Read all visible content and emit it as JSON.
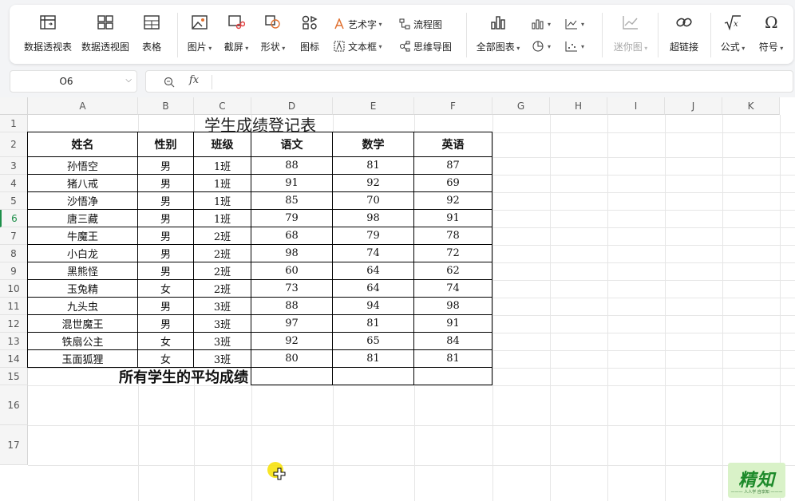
{
  "ribbon": {
    "pivot_table": "数据透视表",
    "pivot_chart": "数据透视图",
    "table": "表格",
    "picture": "图片",
    "screenshot": "截屏",
    "shapes": "形状",
    "icons": "图标",
    "wordart": "艺术字",
    "textbox": "文本框",
    "flowchart": "流程图",
    "mindmap": "思维导图",
    "all_charts": "全部图表",
    "sparkline": "迷你图",
    "hyperlink": "超链接",
    "formula": "公式",
    "symbol": "符号"
  },
  "formula_bar": {
    "name_box": "O6",
    "fx": "fx",
    "value": ""
  },
  "columns": [
    "A",
    "B",
    "C",
    "D",
    "E",
    "F",
    "G",
    "H",
    "I",
    "J",
    "K"
  ],
  "rows": [
    "1",
    "2",
    "3",
    "4",
    "5",
    "6",
    "7",
    "8",
    "9",
    "10",
    "11",
    "12",
    "13",
    "14",
    "15",
    "16",
    "17"
  ],
  "sheet": {
    "title": "学生成绩登记表",
    "headers": [
      "姓名",
      "性别",
      "班级",
      "语文",
      "数学",
      "英语"
    ],
    "data": [
      [
        "孙悟空",
        "男",
        "1班",
        "88",
        "81",
        "87"
      ],
      [
        "猪八戒",
        "男",
        "1班",
        "91",
        "92",
        "69"
      ],
      [
        "沙悟净",
        "男",
        "1班",
        "85",
        "70",
        "92"
      ],
      [
        "唐三藏",
        "男",
        "1班",
        "79",
        "98",
        "91"
      ],
      [
        "牛魔王",
        "男",
        "2班",
        "68",
        "79",
        "78"
      ],
      [
        "小白龙",
        "男",
        "2班",
        "98",
        "74",
        "72"
      ],
      [
        "黑熊怪",
        "男",
        "2班",
        "60",
        "64",
        "62"
      ],
      [
        "玉兔精",
        "女",
        "2班",
        "73",
        "64",
        "74"
      ],
      [
        "九头虫",
        "男",
        "3班",
        "88",
        "94",
        "98"
      ],
      [
        "混世魔王",
        "男",
        "3班",
        "97",
        "81",
        "91"
      ],
      [
        "铁扇公主",
        "女",
        "3班",
        "92",
        "65",
        "84"
      ],
      [
        "玉面狐狸",
        "女",
        "3班",
        "80",
        "81",
        "81"
      ]
    ],
    "average_label": "所有学生的平均成绩"
  },
  "watermark": {
    "main": "精知",
    "sub": "——— 人人学 自享知 ———"
  },
  "selected_row": "6"
}
